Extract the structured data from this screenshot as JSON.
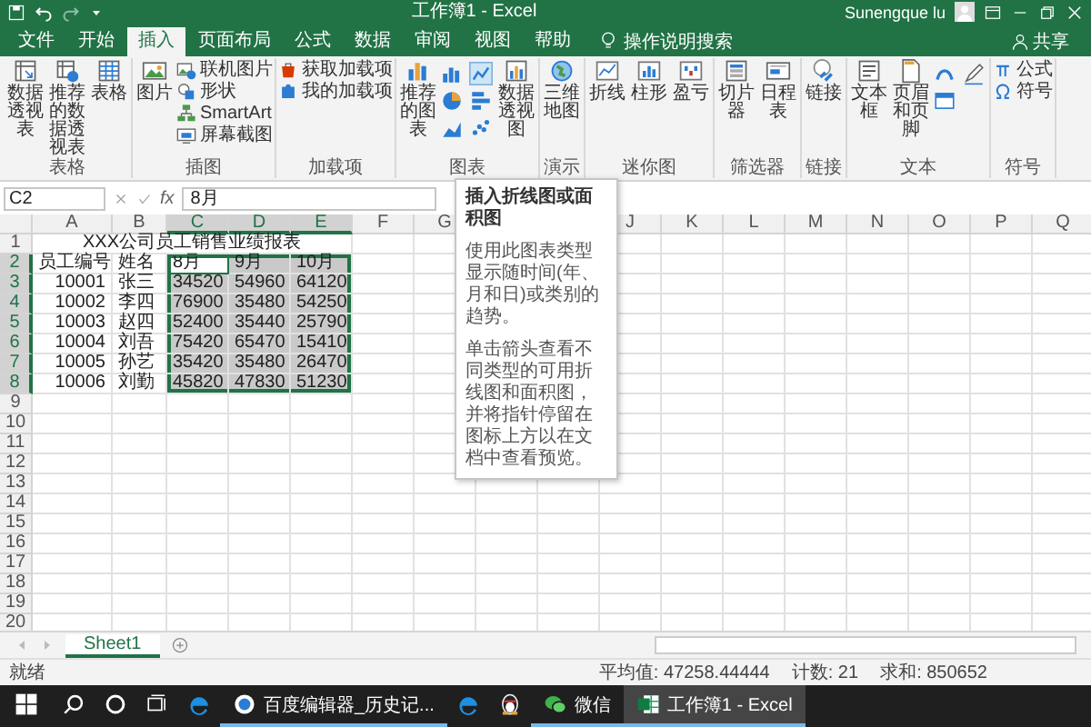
{
  "window": {
    "title": "工作簿1 - Excel",
    "user": "Sunengque lu"
  },
  "tabs": [
    {
      "label": "文件",
      "selected": false
    },
    {
      "label": "开始",
      "selected": false
    },
    {
      "label": "插入",
      "selected": true
    },
    {
      "label": "页面布局",
      "selected": false
    },
    {
      "label": "公式",
      "selected": false
    },
    {
      "label": "数据",
      "selected": false
    },
    {
      "label": "审阅",
      "selected": false
    },
    {
      "label": "视图",
      "selected": false
    },
    {
      "label": "帮助",
      "selected": false
    }
  ],
  "tell_me": "操作说明搜索",
  "share": "共享",
  "ribbon": [
    {
      "label": "表格",
      "items": [
        {
          "kind": "big",
          "label": "数据透视表"
        },
        {
          "kind": "big",
          "label": "推荐的数据透视表"
        },
        {
          "kind": "big",
          "label": "表格"
        }
      ]
    },
    {
      "label": "插图",
      "items": [
        {
          "kind": "big",
          "label": "图片"
        },
        {
          "kind": "stack",
          "items": [
            {
              "label": "联机图片"
            },
            {
              "label": "形状"
            },
            {
              "label": "SmartArt"
            },
            {
              "label": "屏幕截图"
            }
          ]
        }
      ]
    },
    {
      "label": "加载项",
      "items": [
        {
          "kind": "stack",
          "items": [
            {
              "label": "获取加载项"
            },
            {
              "label": "我的加载项"
            }
          ]
        }
      ]
    },
    {
      "label": "图表",
      "items": [
        {
          "kind": "big",
          "label": "推荐的图表"
        },
        {
          "kind": "chart-gallery"
        },
        {
          "kind": "big",
          "label": "数据透视图"
        }
      ]
    },
    {
      "label": "演示",
      "items": [
        {
          "kind": "big",
          "label": "三维地图"
        }
      ]
    },
    {
      "label": "迷你图",
      "items": [
        {
          "kind": "big",
          "label": "折线"
        },
        {
          "kind": "big",
          "label": "柱形"
        },
        {
          "kind": "big",
          "label": "盈亏"
        }
      ]
    },
    {
      "label": "筛选器",
      "items": [
        {
          "kind": "big",
          "label": "切片器"
        },
        {
          "kind": "big",
          "label": "日程表"
        }
      ]
    },
    {
      "label": "链接",
      "items": [
        {
          "kind": "big",
          "label": "链接"
        }
      ]
    },
    {
      "label": "文本",
      "items": [
        {
          "kind": "big",
          "label": "文本框"
        },
        {
          "kind": "big",
          "label": "页眉和页脚"
        },
        {
          "kind": "text-tools"
        }
      ]
    },
    {
      "label": "符号",
      "items": [
        {
          "kind": "stack",
          "items": [
            {
              "label": "公式"
            },
            {
              "label": "符号"
            }
          ]
        }
      ]
    }
  ],
  "formula_bar": {
    "name_box": "C2",
    "function_label": "fx",
    "value": "8月"
  },
  "tooltip": {
    "title": "插入折线图或面积图",
    "paragraphs": [
      "使用此图表类型显示随时间(年、月和日)或类别的趋势。",
      "单击箭头查看不同类型的可用折线图和面积图，并将指针停留在图标上方以在文档中查看预览。"
    ]
  },
  "sheet": {
    "columns": [
      "A",
      "B",
      "C",
      "D",
      "E",
      "F",
      "G",
      null,
      null,
      "J",
      "K",
      "L",
      "M",
      "N",
      "O",
      "P",
      "Q"
    ],
    "rows": [
      {
        "number": "1",
        "cells": [
          {
            "text": "XXX公司员工销售业绩报表",
            "kind": "title",
            "selected": false,
            "active": false
          }
        ]
      },
      {
        "number": "2",
        "cells": [
          {
            "text": "员工编号",
            "kind": "text",
            "selected": false,
            "active": false
          },
          {
            "text": "姓名",
            "kind": "text",
            "selected": false,
            "active": false
          },
          {
            "text": "8月",
            "kind": "text",
            "selected": true,
            "active": true
          },
          {
            "text": "9月",
            "kind": "text",
            "selected": true,
            "active": false
          },
          {
            "text": "10月",
            "kind": "text",
            "selected": true,
            "active": false
          }
        ]
      },
      {
        "number": "3",
        "cells": [
          {
            "text": "10001",
            "kind": "number",
            "selected": false,
            "active": false
          },
          {
            "text": "张三",
            "kind": "text",
            "selected": false,
            "active": false
          },
          {
            "text": "34520",
            "kind": "number",
            "selected": true,
            "active": false
          },
          {
            "text": "54960",
            "kind": "number",
            "selected": true,
            "active": false
          },
          {
            "text": "64120",
            "kind": "number",
            "selected": true,
            "active": false
          }
        ]
      },
      {
        "number": "4",
        "cells": [
          {
            "text": "10002",
            "kind": "number",
            "selected": false,
            "active": false
          },
          {
            "text": "李四",
            "kind": "text",
            "selected": false,
            "active": false
          },
          {
            "text": "76900",
            "kind": "number",
            "selected": true,
            "active": false
          },
          {
            "text": "35480",
            "kind": "number",
            "selected": true,
            "active": false
          },
          {
            "text": "54250",
            "kind": "number",
            "selected": true,
            "active": false
          }
        ]
      },
      {
        "number": "5",
        "cells": [
          {
            "text": "10003",
            "kind": "number",
            "selected": false,
            "active": false
          },
          {
            "text": "赵四",
            "kind": "text",
            "selected": false,
            "active": false
          },
          {
            "text": "52400",
            "kind": "number",
            "selected": true,
            "active": false
          },
          {
            "text": "35440",
            "kind": "number",
            "selected": true,
            "active": false
          },
          {
            "text": "25790",
            "kind": "number",
            "selected": true,
            "active": false
          }
        ]
      },
      {
        "number": "6",
        "cells": [
          {
            "text": "10004",
            "kind": "number",
            "selected": false,
            "active": false
          },
          {
            "text": "刘吾",
            "kind": "text",
            "selected": false,
            "active": false
          },
          {
            "text": "75420",
            "kind": "number",
            "selected": true,
            "active": false
          },
          {
            "text": "65470",
            "kind": "number",
            "selected": true,
            "active": false
          },
          {
            "text": "15410",
            "kind": "number",
            "selected": true,
            "active": false
          }
        ]
      },
      {
        "number": "7",
        "cells": [
          {
            "text": "10005",
            "kind": "number",
            "selected": false,
            "active": false
          },
          {
            "text": "孙艺",
            "kind": "text",
            "selected": false,
            "active": false
          },
          {
            "text": "35420",
            "kind": "number",
            "selected": true,
            "active": false
          },
          {
            "text": "35480",
            "kind": "number",
            "selected": true,
            "active": false
          },
          {
            "text": "26470",
            "kind": "number",
            "selected": true,
            "active": false
          }
        ]
      },
      {
        "number": "8",
        "cells": [
          {
            "text": "10006",
            "kind": "number",
            "selected": false,
            "active": false
          },
          {
            "text": "刘勤",
            "kind": "text",
            "selected": false,
            "active": false
          },
          {
            "text": "45820",
            "kind": "number",
            "selected": true,
            "active": false
          },
          {
            "text": "47830",
            "kind": "number",
            "selected": true,
            "active": false
          },
          {
            "text": "51230",
            "kind": "number",
            "selected": true,
            "active": false
          }
        ]
      },
      {
        "number": "9"
      },
      {
        "number": "10"
      },
      {
        "number": "11"
      },
      {
        "number": "12"
      },
      {
        "number": "13"
      },
      {
        "number": "14"
      },
      {
        "number": "15"
      },
      {
        "number": "16"
      },
      {
        "number": "17"
      },
      {
        "number": "18"
      },
      {
        "number": "19"
      },
      {
        "number": "20"
      }
    ]
  },
  "sheet_tabs": [
    {
      "label": "Sheet1",
      "selected": true
    }
  ],
  "status_bar": {
    "mode": "就绪",
    "stats": [
      "平均值: 47258.44444",
      "计数: 21",
      "求和: 850652"
    ]
  },
  "taskbar": [
    {
      "kind": "start",
      "active": false
    },
    {
      "kind": "search",
      "active": false
    },
    {
      "kind": "cortana",
      "active": false
    },
    {
      "kind": "taskview",
      "active": false
    },
    {
      "kind": "edge",
      "active": false
    },
    {
      "kind": "browser-window",
      "label": "百度编辑器_历史记...",
      "active": false
    },
    {
      "kind": "edge",
      "active": false
    },
    {
      "kind": "app",
      "active": false
    },
    {
      "kind": "chat-window",
      "label": "微信",
      "active": false
    },
    {
      "kind": "excel-window",
      "label": "工作簿1 - Excel",
      "active": true
    }
  ]
}
